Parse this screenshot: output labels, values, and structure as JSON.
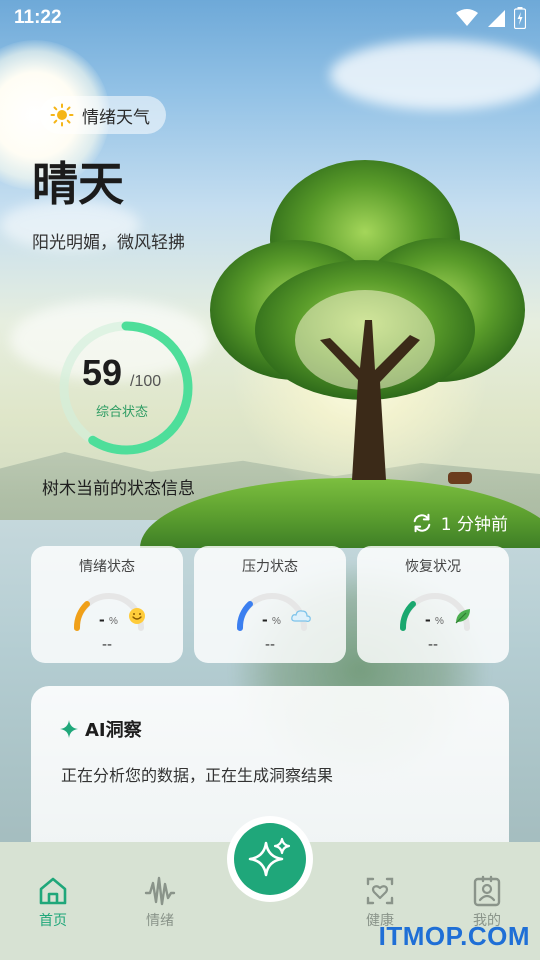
{
  "status_bar": {
    "time": "11:22"
  },
  "header": {
    "weather_chip_label": "情绪天气",
    "title": "晴天",
    "subtitle": "阳光明媚，微风轻拂"
  },
  "score": {
    "value": "59",
    "max": "/100",
    "label": "综合状态",
    "fraction": 0.59,
    "tree_status_label": "树木当前的状态信息"
  },
  "refresh": {
    "label": "1 分钟前"
  },
  "metrics": [
    {
      "title": "情绪状态",
      "value": "-",
      "unit": "%",
      "bottom": "--",
      "color": "#f0a019",
      "icon": "smile-emoji-icon"
    },
    {
      "title": "压力状态",
      "value": "-",
      "unit": "%",
      "bottom": "--",
      "color": "#3b7ff0",
      "icon": "cloud-icon"
    },
    {
      "title": "恢复状况",
      "value": "-",
      "unit": "%",
      "bottom": "--",
      "color": "#1aa86f",
      "icon": "leaf-icon"
    }
  ],
  "insight": {
    "title": "AI洞察",
    "text": "正在分析您的数据，正在生成洞察结果"
  },
  "nav": {
    "items": [
      {
        "label": "首页",
        "icon": "home-icon",
        "active": true
      },
      {
        "label": "情绪",
        "icon": "waveform-icon",
        "active": false
      },
      {
        "label": "健康",
        "icon": "heart-check-icon",
        "active": false
      },
      {
        "label": "我的",
        "icon": "profile-badge-icon",
        "active": false
      }
    ],
    "fab_icon": "sparkles-icon"
  },
  "watermark": "ITMOP.COM",
  "colors": {
    "accent": "#1fa77a",
    "ring": "#4ede9a",
    "nav_active": "#1fa77a",
    "nav_inactive": "#8a948a"
  }
}
